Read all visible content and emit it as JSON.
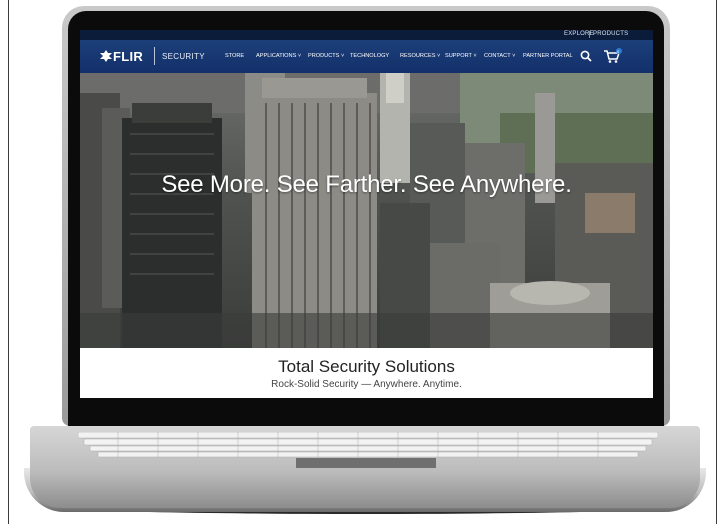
{
  "utility_bar": {
    "explore_label": "EXPLORE",
    "products_label": "PRODUCTS"
  },
  "brand": {
    "logo_text": "FLIR",
    "division": "SECURITY"
  },
  "nav": {
    "items": [
      {
        "label": "STORE"
      },
      {
        "label": "APPLICATIONS ˅"
      },
      {
        "label": "PRODUCTS ˅"
      },
      {
        "label": "TECHNOLOGY"
      },
      {
        "label": "RESOURCES ˅"
      },
      {
        "label": "SUPPORT ˅"
      },
      {
        "label": "CONTACT ˅"
      },
      {
        "label": "PARTNER PORTAL"
      }
    ],
    "search_icon": "search-icon",
    "cart_icon": "cart-icon",
    "cart_count": "0"
  },
  "hero": {
    "headline": "See More. See Farther. See Anywhere."
  },
  "promo": {
    "title": "Total Security Solutions",
    "subtitle": "Rock-Solid Security — Anywhere. Anytime."
  },
  "colors": {
    "nav_bg": "#1c3f7a",
    "utility_bg": "#0a1c3a",
    "accent": "#2a7fd4"
  }
}
